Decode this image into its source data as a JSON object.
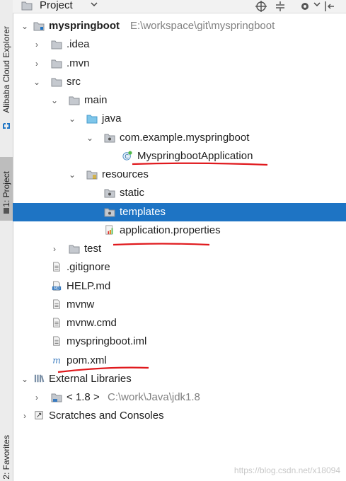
{
  "sidebar": {
    "cloud_tab": "Alibaba Cloud Explorer",
    "project_tab": "1: Project",
    "favorites_tab": "2: Favorites"
  },
  "header": {
    "title": "Project"
  },
  "tree": {
    "root": {
      "label": "myspringboot",
      "path": "E:\\workspace\\git\\myspringboot"
    },
    "idea": ".idea",
    "mvn": ".mvn",
    "src": "src",
    "main": "main",
    "java": "java",
    "package": "com.example.myspringboot",
    "app_class": "MyspringbootApplication",
    "resources": "resources",
    "static": "static",
    "templates": "templates",
    "app_props": "application.properties",
    "test": "test",
    "gitignore": ".gitignore",
    "help": "HELP.md",
    "mvnw": "mvnw",
    "mvnw_cmd": "mvnw.cmd",
    "iml": "myspringboot.iml",
    "pom": "pom.xml",
    "ext_libs": "External Libraries",
    "jdk": {
      "label": "< 1.8 >",
      "path": "C:\\work\\Java\\jdk1.8"
    },
    "scratches": "Scratches and Consoles"
  },
  "watermark": "https://blog.csdn.net/x18094"
}
